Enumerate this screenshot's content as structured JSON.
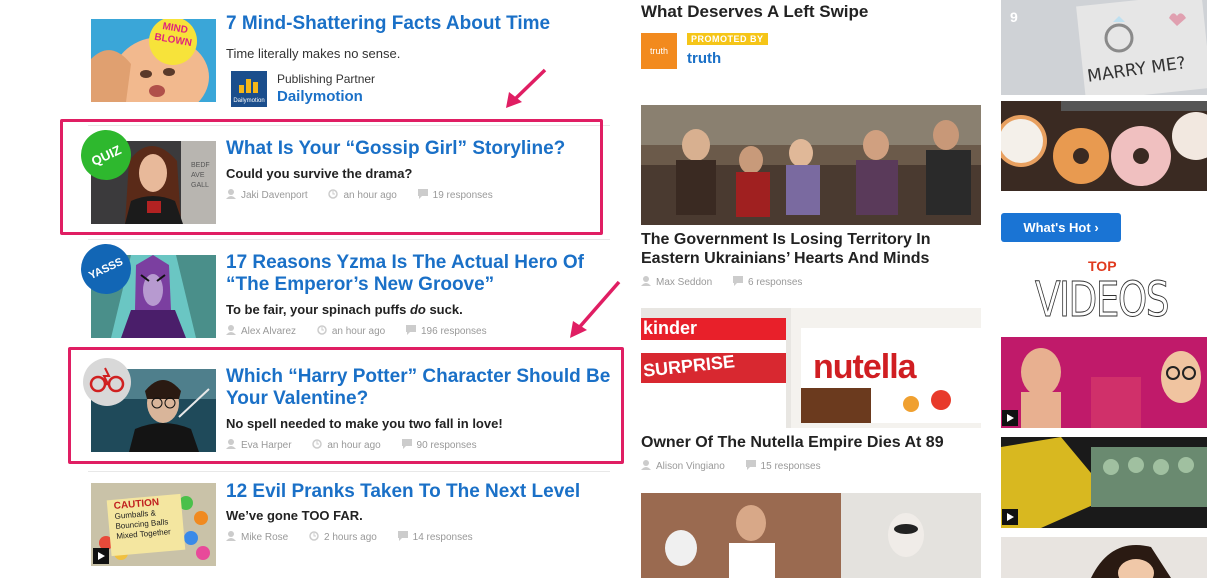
{
  "feed": [
    {
      "title": "7 Mind-Shattering Facts About Time",
      "description": "Time literally makes no sense.",
      "partner_label": "Publishing Partner",
      "partner_name": "Dailymotion",
      "partner_logo_text": "Dailymotion",
      "thumb_text_1": "MIND",
      "thumb_text_2": "BLOWN"
    },
    {
      "title": "What Is Your “Gossip Girl” Storyline?",
      "description": "Could you survive the drama?",
      "author": "Jaki Davenport",
      "time": "an hour ago",
      "responses": "19 responses",
      "badge": "QUIZ"
    },
    {
      "title": "17 Reasons Yzma Is The Actual Hero Of “The Emperor’s New Groove”",
      "description_pre": "To be fair, your spinach puffs ",
      "description_em": "do",
      "description_post": " suck.",
      "author": "Alex Alvarez",
      "time": "an hour ago",
      "responses": "196 responses",
      "badge": "YASSS"
    },
    {
      "title": "Which “Harry Potter” Character Should Be Your Valentine?",
      "description": "No spell needed to make you two fall in love!",
      "author": "Eva Harper",
      "time": "an hour ago",
      "responses": "90 responses"
    },
    {
      "title": "12 Evil Pranks Taken To The Next Level",
      "description": "We’ve gone TOO FAR.",
      "author": "Mike Rose",
      "time": "2 hours ago",
      "responses": "14 responses",
      "thumb_sign_1": "CAUTION",
      "thumb_sign_2": "Gumballs &",
      "thumb_sign_3": "Bouncing Balls",
      "thumb_sign_4": "Mixed Together"
    }
  ],
  "middle": {
    "top_title": "What Deserves A Left Swipe",
    "promoted_label": "PROMOTED BY",
    "promoter": "truth",
    "promoter_logo": "truth",
    "story1_title": "The Government Is Losing Territory In Eastern Ukrainians’ Hearts And Minds",
    "story1_author": "Max Seddon",
    "story1_responses": "6 responses",
    "story2_title": "Owner Of The Nutella Empire Dies At 89",
    "story2_author": "Alison Vingiano",
    "story2_responses": "15 responses",
    "nutella_text": "nutella",
    "kinder_text": "kinder",
    "surprise_text": "SURPRISE"
  },
  "right": {
    "card_number": "9",
    "marry_text": "MARRY ME?",
    "whats_hot_label": "What's Hot ›",
    "top_label": "TOP",
    "videos_label": "VIDEOS"
  },
  "colors": {
    "link_blue": "#1a70c7",
    "highlight_pink": "#e01e63",
    "quiz_green": "#2eb82e",
    "yasss_blue": "#1266b5",
    "promoted_yellow": "#f5c518",
    "whats_hot_blue": "#1a74d4",
    "top_red": "#e03a1e"
  }
}
